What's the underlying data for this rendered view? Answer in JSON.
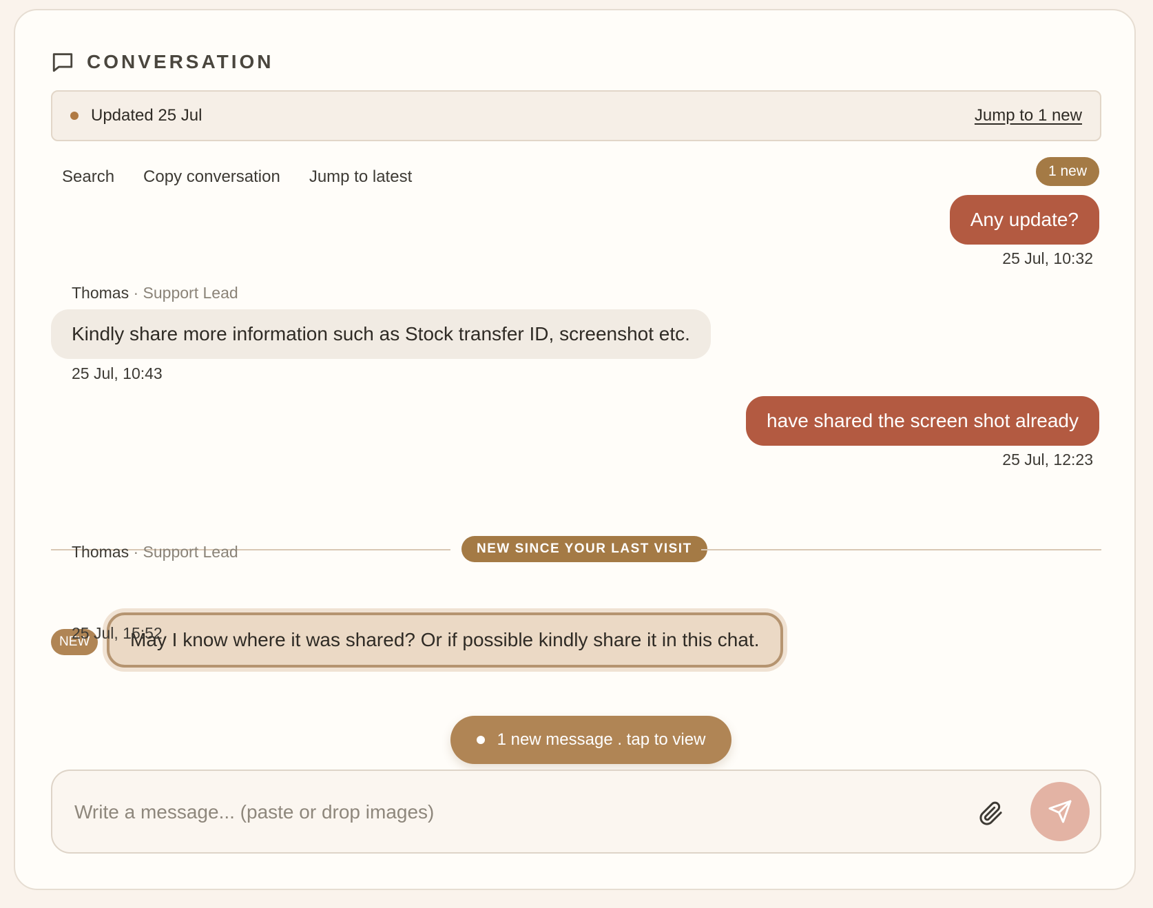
{
  "header": {
    "title": "CONVERSATION",
    "icon": "chat-bubble-icon"
  },
  "banner": {
    "status": "Updated 25 Jul",
    "jump_link": "Jump to 1 new"
  },
  "toolbar": {
    "search": "Search",
    "copy": "Copy conversation",
    "jump_latest": "Jump to latest",
    "new_count": "1 new"
  },
  "messages": [
    {
      "direction": "outgoing",
      "text": "Any update?",
      "time": "25 Jul, 10:32"
    },
    {
      "direction": "incoming",
      "sender": "Thomas",
      "role": "· Support Lead",
      "text": "Kindly share more information such as Stock transfer ID, screenshot etc.",
      "time": "25 Jul, 10:43"
    },
    {
      "direction": "outgoing",
      "text": "have shared the screen shot already",
      "time": "25 Jul, 12:23"
    },
    {
      "direction": "incoming",
      "sender": "Thomas",
      "role": "· Support Lead",
      "text": "May I know where it was shared? Or if possible kindly share it in this chat.",
      "time": "25 Jul, 15:52",
      "tag": "NEW"
    }
  ],
  "divider": {
    "label": "NEW SINCE YOUR LAST VISIT"
  },
  "toast": {
    "text": "1 new message . tap to view"
  },
  "composer": {
    "placeholder": "Write a message... (paste or drop images)",
    "value": "",
    "attach_icon": "paperclip-icon",
    "send_icon": "send-icon"
  },
  "colors": {
    "accent": "#a47a45",
    "outgoing_bubble": "#b35a41",
    "incoming_bubble": "#f1ebe3",
    "send_button": "#e3b3a4"
  }
}
